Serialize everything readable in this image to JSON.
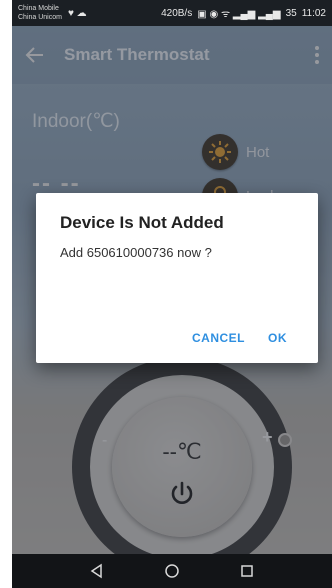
{
  "status_bar": {
    "carrier_1": "China Mobile",
    "carrier_2": "China Unicom",
    "net_speed": "420B/s",
    "battery": "35",
    "time": "11:02"
  },
  "app_bar": {
    "title": "Smart Thermostat"
  },
  "main": {
    "indoor_label": "Indoor(℃)",
    "indoor_value": "-- --",
    "hot_label": "Hot",
    "lock_label": "Lock"
  },
  "dial": {
    "set_temp": "--℃",
    "minus": "-",
    "plus": "+"
  },
  "dialog": {
    "title": "Device Is Not Added",
    "message": "Add 650610000736 now ?",
    "cancel_label": "CANCEL",
    "ok_label": "OK"
  },
  "colors": {
    "accent": "#2f8fe0",
    "status_bar": "#1b1f24",
    "nav_bar": "#121417"
  }
}
